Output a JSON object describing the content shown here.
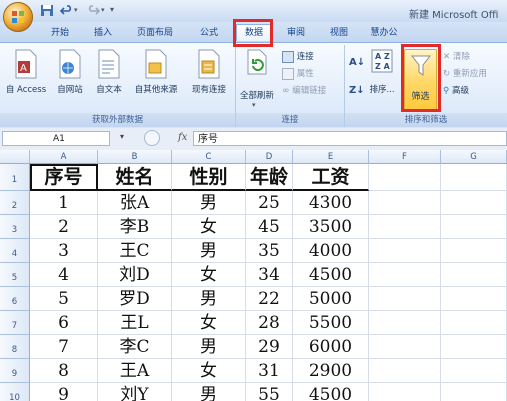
{
  "window": {
    "title": "新建 Microsoft Offi"
  },
  "tabs": [
    "开始",
    "插入",
    "页面布局",
    "公式",
    "数据",
    "审阅",
    "视图",
    "慧办公"
  ],
  "active_tab": "数据",
  "ribbon": {
    "get_external": {
      "title": "获取外部数据",
      "buttons": [
        "自 Access",
        "自网站",
        "自文本",
        "自其他来源",
        "现有连接"
      ]
    },
    "connections": {
      "title": "连接",
      "refresh_all": "全部刷新",
      "connections": "连接",
      "properties": "属性",
      "edit_links": "编辑链接"
    },
    "sort_filter": {
      "title": "排序和筛选",
      "sort_az": "A Z",
      "sort_za": "Z A",
      "sort": "排序...",
      "filter": "筛选",
      "clear": "清除",
      "reapply": "重新应用",
      "advanced": "高级"
    }
  },
  "formula_bar": {
    "name_box": "A1",
    "fx": "fx",
    "value": "序号"
  },
  "columns": [
    "A",
    "B",
    "C",
    "D",
    "E",
    "F",
    "G"
  ],
  "rows": [
    "1",
    "2",
    "3",
    "4",
    "5",
    "6",
    "7",
    "8",
    "9",
    "10"
  ],
  "table": {
    "headers": [
      "序号",
      "姓名",
      "性别",
      "年龄",
      "工资"
    ],
    "data": [
      [
        "1",
        "张A",
        "男",
        "25",
        "4300"
      ],
      [
        "2",
        "李B",
        "女",
        "45",
        "3500"
      ],
      [
        "3",
        "王C",
        "男",
        "35",
        "4000"
      ],
      [
        "4",
        "刘D",
        "女",
        "34",
        "4500"
      ],
      [
        "5",
        "罗D",
        "男",
        "22",
        "5000"
      ],
      [
        "6",
        "王L",
        "女",
        "28",
        "5500"
      ],
      [
        "7",
        "李C",
        "男",
        "29",
        "6000"
      ],
      [
        "8",
        "王A",
        "女",
        "31",
        "2900"
      ],
      [
        "9",
        "刘Y",
        "男",
        "55",
        "4500"
      ]
    ]
  },
  "colors": {
    "highlight": "#e32a2a",
    "ribbon": "#dfeaf8",
    "accent": "#15428b"
  }
}
